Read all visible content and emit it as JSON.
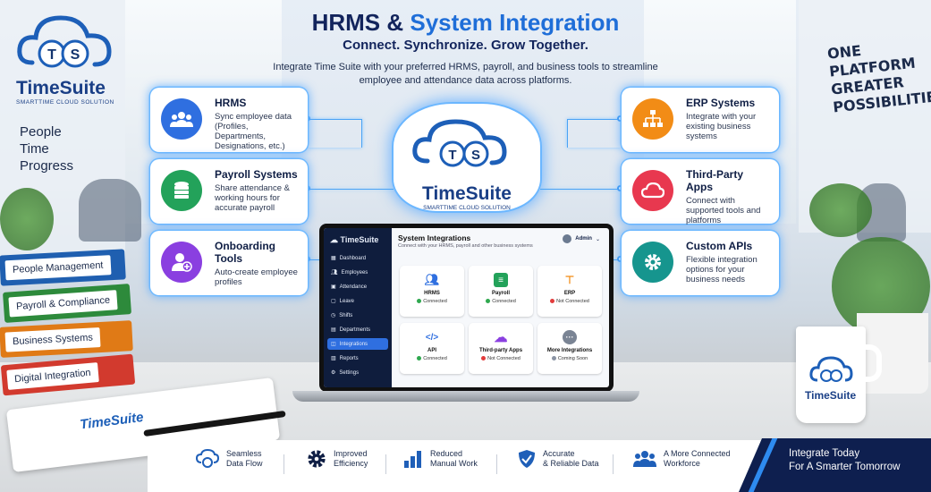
{
  "header": {
    "title_part1": "HRMS & ",
    "title_part2": "System Integration",
    "tagline": "Connect. Synchronize. Grow Together.",
    "description_line1": "Integrate Time Suite with your preferred HRMS, payroll, and business tools to streamline",
    "description_line2": "employee and attendance data across platforms."
  },
  "brand": {
    "logo_letters": "TS",
    "name": "TimeSuite",
    "sub": "SMARTTIME CLOUD SOLUTION",
    "motto": [
      "People",
      "Time",
      "Progress"
    ]
  },
  "slogan": [
    "ONE",
    "PLATFORM",
    "GREATER",
    "POSSIBILITIES"
  ],
  "cards_left": [
    {
      "title": "HRMS",
      "desc": "Sync employee data (Profiles, Departments, Designations, etc.)",
      "icon": "people-icon",
      "color": "#2f6fe0"
    },
    {
      "title": "Payroll Systems",
      "desc": "Share attendance & working hours for accurate payroll",
      "icon": "database-icon",
      "color": "#23a25a"
    },
    {
      "title": "Onboarding Tools",
      "desc": "Auto-create employee profiles",
      "icon": "add-user-icon",
      "color": "#8a3fe0"
    }
  ],
  "cards_right": [
    {
      "title": "ERP Systems",
      "desc": "Integrate with your existing business systems",
      "icon": "hierarchy-icon",
      "color": "#f28c16"
    },
    {
      "title": "Third-Party Apps",
      "desc": "Connect with supported tools and platforms",
      "icon": "cloud-icon",
      "color": "#e8384f"
    },
    {
      "title": "Custom APIs",
      "desc": "Flexible integration options for your business needs",
      "icon": "gear-icon",
      "color": "#16958e"
    }
  ],
  "app": {
    "brand": "TimeSuite",
    "page_title": "System Integrations",
    "page_subtitle": "Connect with your HRMS, payroll and other business systems",
    "user": "Admin",
    "nav": [
      "Dashboard",
      "Employees",
      "Attendance",
      "Leave",
      "Shifts",
      "Departments",
      "Integrations",
      "Reports",
      "Settings"
    ],
    "active_nav": "Integrations",
    "tiles": [
      {
        "name": "HRMS",
        "status": "Connected",
        "status_color": "#2fa84f",
        "icon": "people-icon",
        "color": "#2f6fe0"
      },
      {
        "name": "Payroll",
        "status": "Connected",
        "status_color": "#2fa84f",
        "icon": "document-icon",
        "color": "#23a25a"
      },
      {
        "name": "ERP",
        "status": "Not Connected",
        "status_color": "#e23b3b",
        "icon": "hierarchy-icon",
        "color": "#f28c16"
      },
      {
        "name": "API",
        "status": "Connected",
        "status_color": "#2fa84f",
        "icon": "code-icon",
        "color": "#2f6fe0"
      },
      {
        "name": "Third-party Apps",
        "status": "Not Connected",
        "status_color": "#e23b3b",
        "icon": "cloud-icon",
        "color": "#8a3fe0"
      },
      {
        "name": "More Integrations",
        "status": "Coming Soon",
        "status_color": "#8a93a3",
        "icon": "more-icon",
        "color": "#7a8494"
      }
    ]
  },
  "binders": [
    "People Management",
    "Payroll & Compliance",
    "Business Systems",
    "Digital Integration"
  ],
  "notepad_brand": "TimeSuite",
  "mug_brand": "TimeSuite",
  "features": [
    {
      "line1": "Seamless",
      "line2": "Data Flow",
      "icon": "cloud-sync-icon"
    },
    {
      "line1": "Improved",
      "line2": "Efficiency",
      "icon": "gear-icon"
    },
    {
      "line1": "Reduced",
      "line2": "Manual Work",
      "icon": "bar-chart-icon"
    },
    {
      "line1": "Accurate",
      "line2": "& Reliable Data",
      "icon": "shield-check-icon"
    },
    {
      "line1": "A More Connected",
      "line2": "Workforce",
      "icon": "team-icon"
    }
  ],
  "cta": {
    "line1": "Integrate Today",
    "line2": "For A Smarter Tomorrow"
  },
  "colors": {
    "navy": "#0e1f4f",
    "accent": "#1f6ed8",
    "glow": "#4aa3f5"
  }
}
